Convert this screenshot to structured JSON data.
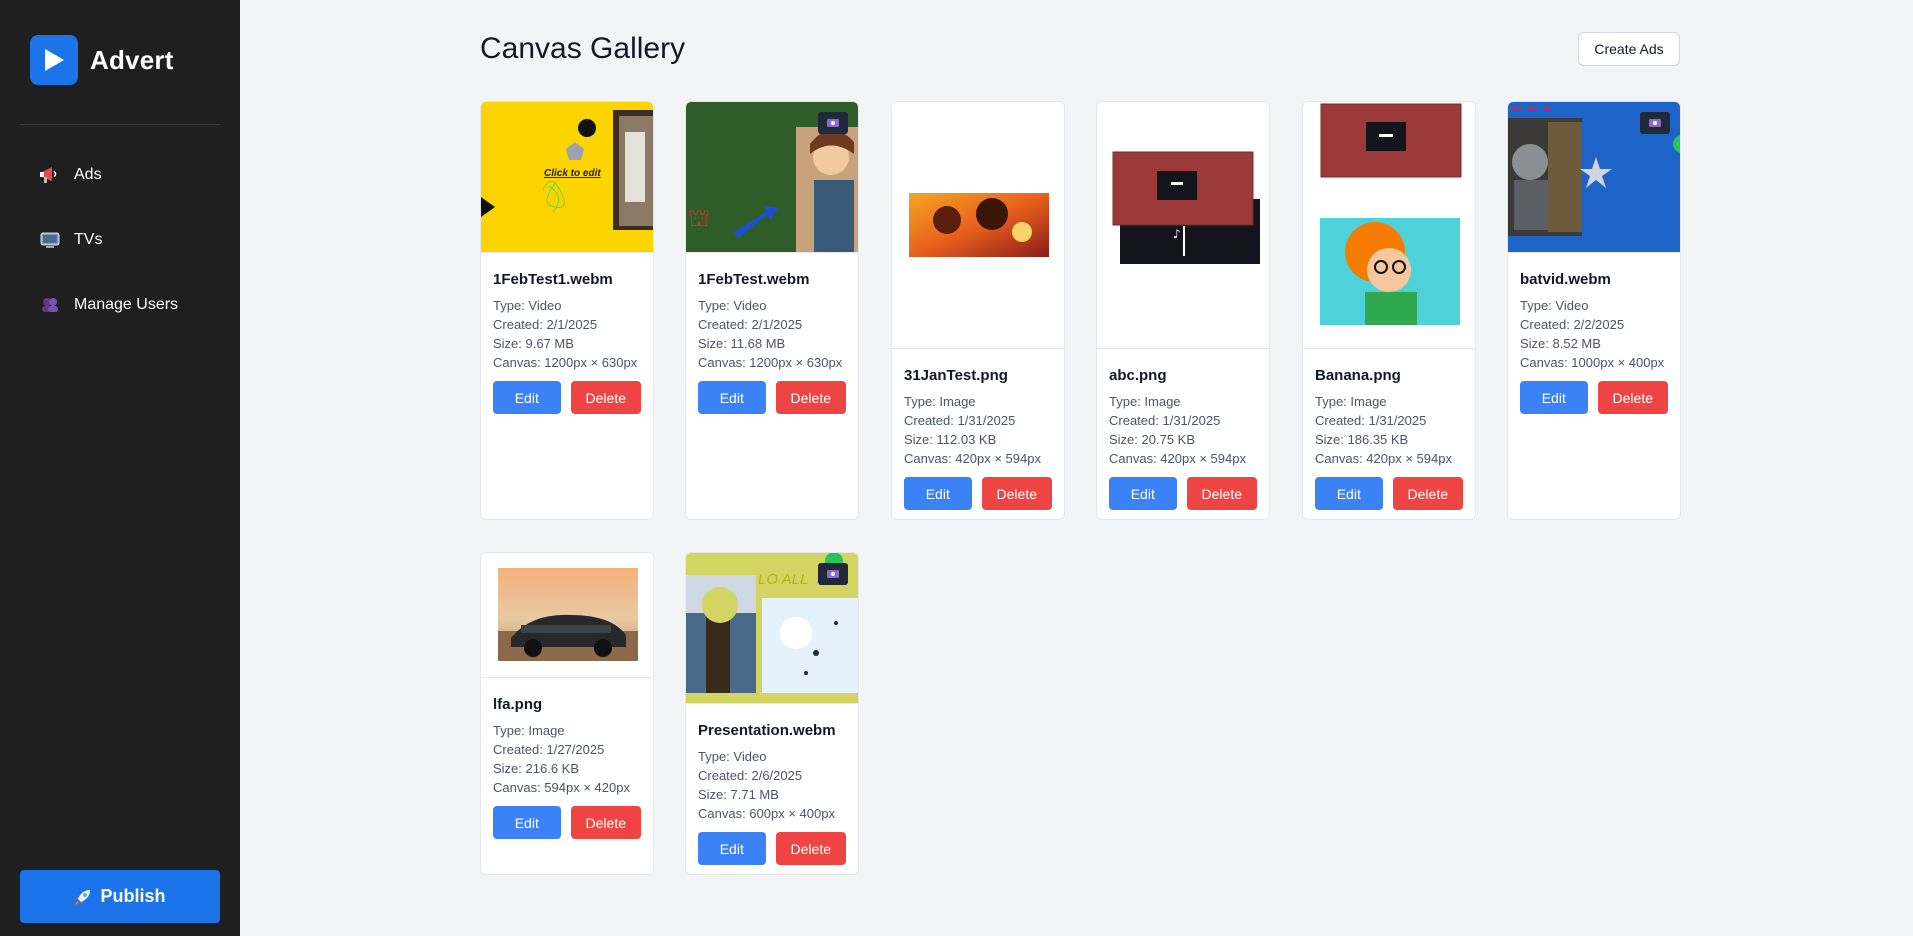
{
  "sidebar": {
    "brand": "Advert",
    "items": [
      {
        "label": "Ads",
        "icon": "megaphone-icon"
      },
      {
        "label": "TVs",
        "icon": "tv-icon"
      },
      {
        "label": "Manage Users",
        "icon": "users-icon"
      }
    ],
    "publish_label": "Publish",
    "publish_icon": "rocket-icon"
  },
  "header": {
    "title": "Canvas Gallery",
    "create_label": "Create Ads"
  },
  "cards": [
    {
      "name": "1FebTest1.webm",
      "type": "Type: Video",
      "created": "Created: 2/1/2025",
      "size": "Size: 9.67 MB",
      "canvas": "Canvas: 1200px × 630px",
      "thumb_text": "Click to edit"
    },
    {
      "name": "1FebTest.webm",
      "type": "Type: Video",
      "created": "Created: 2/1/2025",
      "size": "Size: 11.68 MB",
      "canvas": "Canvas: 1200px × 630px"
    },
    {
      "name": "31JanTest.png",
      "type": "Type: Image",
      "created": "Created: 1/31/2025",
      "size": "Size: 112.03 KB",
      "canvas": "Canvas: 420px × 594px"
    },
    {
      "name": "abc.png",
      "type": "Type: Image",
      "created": "Created: 1/31/2025",
      "size": "Size: 20.75 KB",
      "canvas": "Canvas: 420px × 594px"
    },
    {
      "name": "Banana.png",
      "type": "Type: Image",
      "created": "Created: 1/31/2025",
      "size": "Size: 186.35 KB",
      "canvas": "Canvas: 420px × 594px"
    },
    {
      "name": "batvid.webm",
      "type": "Type: Video",
      "created": "Created: 2/2/2025",
      "size": "Size: 8.52 MB",
      "canvas": "Canvas: 1000px × 400px"
    },
    {
      "name": "lfa.png",
      "type": "Type: Image",
      "created": "Created: 1/27/2025",
      "size": "Size: 216.6 KB",
      "canvas": "Canvas: 594px × 420px"
    },
    {
      "name": "Presentation.webm",
      "type": "Type: Video",
      "created": "Created: 2/6/2025",
      "size": "Size: 7.71 MB",
      "canvas": "Canvas: 600px × 400px",
      "thumb_text": "LO ALL"
    }
  ],
  "actions": {
    "edit_label": "Edit",
    "delete_label": "Delete"
  },
  "colors": {
    "accent": "#1a73e8",
    "edit": "#3b82f6",
    "delete": "#ef4444",
    "sidebar": "#1f1f1f"
  }
}
